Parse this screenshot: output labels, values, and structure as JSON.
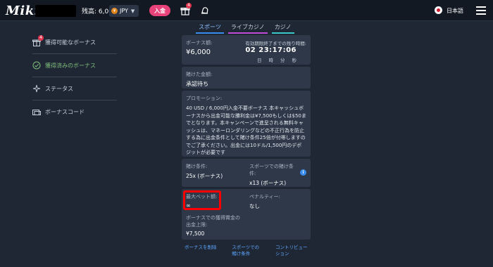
{
  "header": {
    "logo": "Miki",
    "balance_label": "残高: 6,000",
    "currency": "JPY",
    "deposit": "入金",
    "gift_badge": "4",
    "language": "日本語"
  },
  "tabs": [
    {
      "label": "スポーツ"
    },
    {
      "label": "ライブカジノ"
    },
    {
      "label": "カジノ"
    }
  ],
  "sidebar": {
    "items": [
      {
        "label": "獲得可能なボーナス",
        "badge": "4"
      },
      {
        "label": "獲得済みのボーナス"
      },
      {
        "label": "ステータス"
      },
      {
        "label": "ボーナスコード"
      }
    ]
  },
  "bonus": {
    "amount_label": "ボーナス額:",
    "amount": "¥6,000",
    "timer_label": "有効期限終了までの残り時間:",
    "timer": "02 23:17:06",
    "timer_units": [
      "日",
      "時",
      "分",
      "秒"
    ],
    "wagered_label": "賭けた金額:",
    "wagered_value": "承認待ち",
    "promo_label": "プロモーション:",
    "promo_text": "40 USD / 6,000円入金不要ボーナス 本キャッシュボーナスから出金可能な勝利金は¥7,500もしくは$50までとなります。本キャンペーンで進呈される無料キャッシュは、マネーロンダリングなどの不正行為を防止する為に出金条件として賭け条件25倍が付帯しますのでご了承ください。出金には10ドル/1,500円のデポジットが必要です",
    "wager_cond_label": "賭け条件:",
    "wager_cond_value": "25x (ボーナス)",
    "sports_cond_label": "スポーツでの賭け条件:",
    "sports_cond_value": "x13 (ボーナス)",
    "max_bet_label": "最大ベット額:",
    "max_bet_value": "∞",
    "penalty_label": "ペナルティー:",
    "penalty_value": "なし",
    "cap_label": "ボーナスでの獲得賞金の出金上限:",
    "cap_value": "¥7,500"
  },
  "links": {
    "delete": "ボーナスを削除",
    "sports_terms": "スポーツでの賭け条件",
    "contribution": "コントリビューション"
  },
  "colors": {
    "background": "#1f2735",
    "card": "#2e3848",
    "accent_pink": "#e8427b",
    "link_blue": "#5ea8ff",
    "highlight_red": "#ff0000"
  }
}
